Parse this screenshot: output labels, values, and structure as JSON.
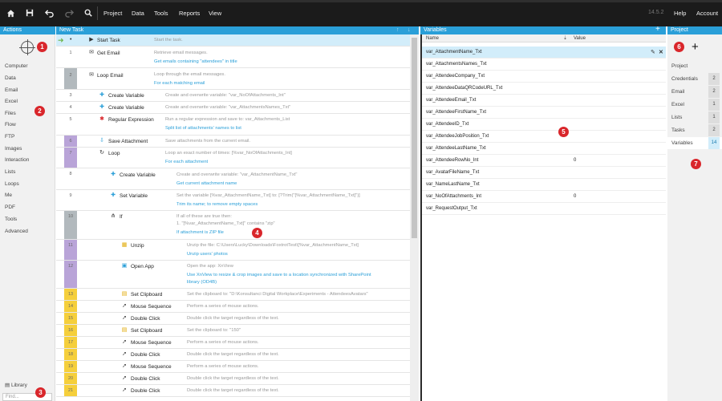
{
  "toolbar": {
    "home_icon": "home-icon",
    "save_icon": "save-icon",
    "undo_icon": "undo-icon",
    "redo_icon": "redo-icon",
    "search_icon": "search-icon",
    "menus": [
      "Project",
      "Data",
      "Tools",
      "Reports",
      "View"
    ],
    "version": "14.5.2",
    "help": "Help",
    "account": "Account"
  },
  "actions": {
    "title": "Actions",
    "items": [
      "Computer",
      "Data",
      "Email",
      "Excel",
      "Files",
      "Flow",
      "FTP",
      "Images",
      "Interaction",
      "Lists",
      "Loops",
      "Me",
      "PDF",
      "Tools",
      "Advanced"
    ],
    "library": "Library",
    "find_placeholder": "Find..."
  },
  "task": {
    "title": "New Task",
    "rows": [
      {
        "no": "",
        "name": "Start Task",
        "desc": "Start the task.",
        "link": ""
      },
      {
        "no": "1",
        "name": "Get Email",
        "desc": "Retrieve email messages.",
        "link": "Get emails containing \"attendees\" in title"
      },
      {
        "no": "2",
        "name": "Loop Email",
        "desc": "Loop through the email messages.",
        "link": "For each matching email"
      },
      {
        "no": "3",
        "name": "Create Variable",
        "desc": "Create and overwrite variable: \"var_NoOfAttachments_Int\"",
        "link": ""
      },
      {
        "no": "4",
        "name": "Create Variable",
        "desc": "Create and overwrite variable: \"var_AttachmentsNames_Txt\"",
        "link": ""
      },
      {
        "no": "5",
        "name": "Regular Expression",
        "desc": "Run a regular expression and save to: var_Attachments_List",
        "link": "Split list of attachments' names to list"
      },
      {
        "no": "6",
        "name": "Save Attachment",
        "desc": "Save attachments from the current email.",
        "link": ""
      },
      {
        "no": "7",
        "name": "Loop",
        "desc": "Loop an exact number of times: [%var_NoOfAttachments_Int]",
        "link": "For each attachment"
      },
      {
        "no": "8",
        "name": "Create Variable",
        "desc": "Create and overwrite variable: \"var_AttachmentName_Txt\"",
        "link": "Get current attachment name"
      },
      {
        "no": "9",
        "name": "Set Variable",
        "desc": "Set the variable [%var_AttachmentName_Txt] to: [?Trim(\"[%var_AttachmentName_Txt]\")]",
        "link": "Trim its name; to remove empty spaces"
      },
      {
        "no": "10",
        "name": "If",
        "desc": "If all of these are true then:",
        "desc2": "1. \"[%var_AttachmentName_Txt]\" contains \"zip\"",
        "link": "If attachment is ZIP file"
      },
      {
        "no": "11",
        "name": "Unzip",
        "desc": "Unzip the file: C:\\Users\\Lucky\\Downloads\\FoxtrotTest\\[%var_AttachmentName_Txt]",
        "link": "Unzip users' photos"
      },
      {
        "no": "12",
        "name": "Open App",
        "desc": "Open the app: XnView",
        "link": "Use XnView to resize & crop images and save to a location synchronized with SharePoint",
        "link2": "library (OD4B)"
      },
      {
        "no": "13",
        "name": "Set Clipboard",
        "desc": "Set the clipboard to: \"D:\\Konsultanci Digital Workplace\\Experiments - AttendeesAvatars\"",
        "link": ""
      },
      {
        "no": "14",
        "name": "Mouse Sequence",
        "desc": "Perform a series of mouse actions.",
        "link": ""
      },
      {
        "no": "15",
        "name": "Double Click",
        "desc": "Double click the target regardless of the text.",
        "link": ""
      },
      {
        "no": "16",
        "name": "Set Clipboard",
        "desc": "Set the clipboard to: \"150\"",
        "link": ""
      },
      {
        "no": "17",
        "name": "Mouse Sequence",
        "desc": "Perform a series of mouse actions.",
        "link": ""
      },
      {
        "no": "18",
        "name": "Double Click",
        "desc": "Double click the target regardless of the text.",
        "link": ""
      },
      {
        "no": "19",
        "name": "Mouse Sequence",
        "desc": "Perform a series of mouse actions.",
        "link": ""
      },
      {
        "no": "20",
        "name": "Double Click",
        "desc": "Double click the target regardless of the text.",
        "link": ""
      },
      {
        "no": "21",
        "name": "Double Click",
        "desc": "Double click the target regardless of the text.",
        "link": ""
      }
    ]
  },
  "variables": {
    "title": "Variables",
    "col_name": "Name",
    "col_value": "Value",
    "rows": [
      {
        "name": "var_AttachmentName_Txt",
        "value": ""
      },
      {
        "name": "var_AttachmentsNames_Txt",
        "value": ""
      },
      {
        "name": "var_AttendeeCompany_Txt",
        "value": ""
      },
      {
        "name": "var_AttendeeDataQRCodeURL_Txt",
        "value": ""
      },
      {
        "name": "var_AttendeeEmail_Txt",
        "value": ""
      },
      {
        "name": "var_AttendeeFirstName_Txt",
        "value": ""
      },
      {
        "name": "var_AttendeeID_Txt",
        "value": ""
      },
      {
        "name": "var_AttendeeJobPosition_Txt",
        "value": ""
      },
      {
        "name": "var_AttendeeLastName_Txt",
        "value": ""
      },
      {
        "name": "var_AttendeeRowNo_Int",
        "value": "0"
      },
      {
        "name": "var_AvatarFileName_Txt",
        "value": ""
      },
      {
        "name": "var_NameLastName_Txt",
        "value": ""
      },
      {
        "name": "var_NoOfAttachments_Int",
        "value": "0"
      },
      {
        "name": "var_RequestOutput_Txt",
        "value": ""
      }
    ]
  },
  "project": {
    "title": "Project",
    "section": "Project",
    "items": [
      {
        "label": "Credentials",
        "count": "2"
      },
      {
        "label": "Email",
        "count": "2"
      },
      {
        "label": "Excel",
        "count": "1"
      },
      {
        "label": "Lists",
        "count": "1"
      },
      {
        "label": "Tasks",
        "count": "2"
      },
      {
        "label": "Variables",
        "count": "14"
      }
    ]
  },
  "badges": [
    "1",
    "2",
    "3",
    "4",
    "5",
    "6",
    "7"
  ],
  "colors": {
    "accent": "#2a9fd8",
    "badge": "#d9262b"
  }
}
